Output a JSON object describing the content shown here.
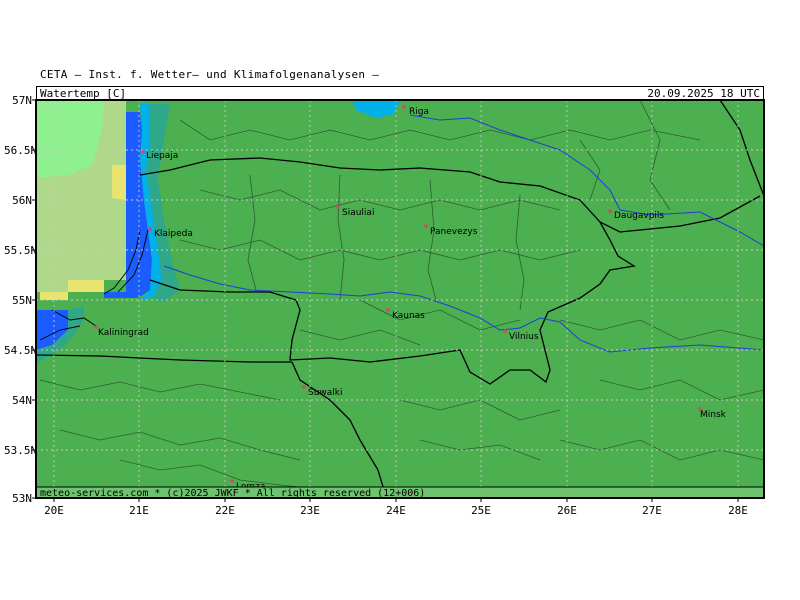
{
  "header": {
    "institute": "CETA – Inst. f. Wetter– und Klimafolgenanalysen –",
    "variable": "Watertemp [C]",
    "datetime": "20.09.2025 18 UTC"
  },
  "footer": {
    "credit": "meteo-services.com * (c)2025 JWKF * All rights reserved (12+006)"
  },
  "axes": {
    "lat_labels": [
      "57N",
      "56.5N",
      "56N",
      "55.5N",
      "55N",
      "54.5N",
      "54N",
      "53.5N",
      "53N"
    ],
    "lon_labels": [
      "20E",
      "21E",
      "22E",
      "23E",
      "24E",
      "25E",
      "26E",
      "27E",
      "28E"
    ]
  },
  "cities": [
    {
      "name": "Riga"
    },
    {
      "name": "Liepaja"
    },
    {
      "name": "Siauliai"
    },
    {
      "name": "Panevezys"
    },
    {
      "name": "Daugavpils"
    },
    {
      "name": "Klaipeda"
    },
    {
      "name": "Kaunas"
    },
    {
      "name": "Vilnius"
    },
    {
      "name": "Kaliningrad"
    },
    {
      "name": "Suwalki"
    },
    {
      "name": "Minsk"
    },
    {
      "name": "Lomza"
    }
  ],
  "colors": {
    "land": "#4caf50",
    "sea_pale": "#b0d88a",
    "sea_green": "#8ef08e",
    "coast_blue": "#1a5cff",
    "coast_cyan": "#00b0e8",
    "coast_yellow": "#e8e470",
    "river": "#1f3fd6",
    "grid": "#c8c8c8",
    "city_dot": "#e04070"
  }
}
